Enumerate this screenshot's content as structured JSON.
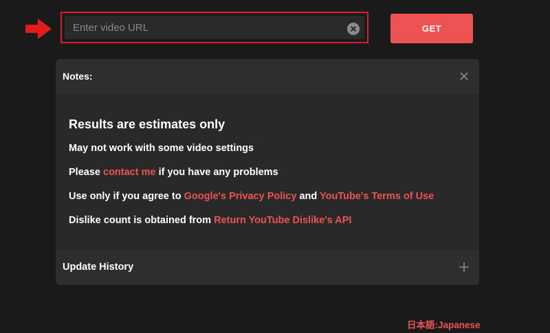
{
  "search": {
    "placeholder": "Enter video URL",
    "value": "",
    "clear_icon": "clear-circle-icon",
    "get_label": "GET"
  },
  "pointer_icon": "red-arrow-right-icon",
  "notes": {
    "title": "Notes:",
    "close_icon": "close-icon",
    "heading": "Results are estimates only",
    "line1": "May not work with some video settings",
    "line2": {
      "before": "Please ",
      "link": "contact me",
      "after": " if you have any problems"
    },
    "line3": {
      "before": "Use only if you agree to ",
      "link1": "Google's Privacy Policy",
      "middle": " and ",
      "link2": "YouTube's Terms of Use"
    },
    "line4": {
      "before": "Dislike count is obtained from ",
      "link": "Return YouTube Dislike's API"
    }
  },
  "update_history": {
    "title": "Update History",
    "expand_icon": "plus-icon"
  },
  "language_link": "日本語:Japanese",
  "colors": {
    "background": "#1b1a1b",
    "accent": "#ec5352",
    "highlight_border": "#d8202a",
    "panel": "#2a292a"
  }
}
